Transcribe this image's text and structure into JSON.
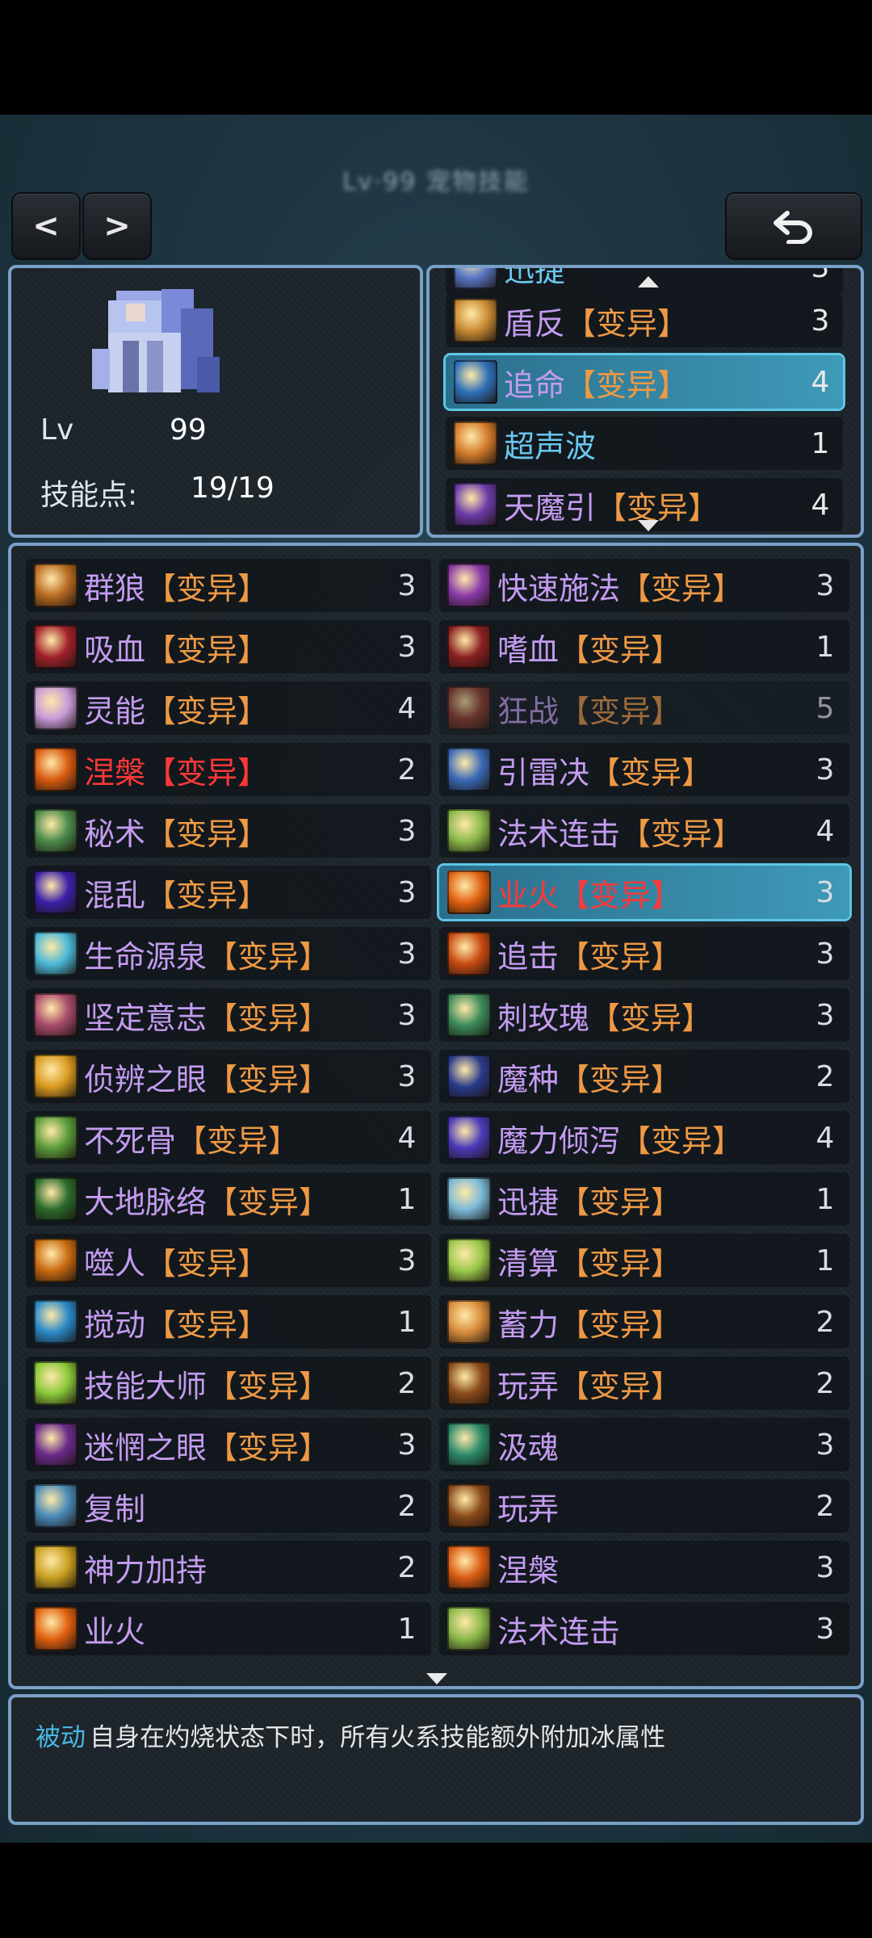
{
  "header": {
    "title": "Lv·99 宠物技能"
  },
  "nav": {
    "prev_label": "<",
    "next_label": ">"
  },
  "character": {
    "lv_label": "Lv",
    "lv_value": "99",
    "skill_points_label": "技能点:",
    "skill_points_value": "19/19"
  },
  "equipped_skills": [
    {
      "base": "迅捷",
      "level": "3",
      "partial": "top",
      "icon": "speed-icon",
      "color": "#5a78c8"
    },
    {
      "base": "盾反",
      "tag": "【变异】",
      "level": "3",
      "icon": "shield-icon",
      "color": "#c88a32"
    },
    {
      "base": "追命",
      "tag": "【变异】",
      "level": "4",
      "selected": true,
      "icon": "chase-icon",
      "color": "#2e70b8"
    },
    {
      "base": "超声波",
      "level": "1",
      "icon": "sonic-icon",
      "color": "#d27a2a"
    },
    {
      "base": "天魔引",
      "tag": "【变异】",
      "level": "4",
      "partial": "bottom",
      "icon": "demon-icon",
      "color": "#6a3aa8"
    }
  ],
  "skills": [
    {
      "base": "群狼",
      "tag": "【变异】",
      "level": "3",
      "icon": "wolf-icon",
      "color": "#b86a20"
    },
    {
      "base": "快速施法",
      "tag": "【变异】",
      "level": "3",
      "icon": "cast-icon",
      "color": "#8a3aa8"
    },
    {
      "base": "吸血",
      "tag": "【变异】",
      "level": "3",
      "icon": "blood-icon",
      "color": "#a0202a"
    },
    {
      "base": "嗜血",
      "tag": "【变异】",
      "level": "1",
      "icon": "bloodlust-icon",
      "color": "#8a2020"
    },
    {
      "base": "灵能",
      "tag": "【变异】",
      "level": "4",
      "icon": "psionic-icon",
      "color": "#c89ad8"
    },
    {
      "base": "狂战",
      "tag": "【变异】",
      "level": "5",
      "dim": true,
      "icon": "berserk-icon",
      "color": "#9a3a2a"
    },
    {
      "base": "涅槃",
      "tag": "【变异】",
      "level": "2",
      "red": true,
      "icon": "phoenix-icon",
      "color": "#d85a10"
    },
    {
      "base": "引雷决",
      "tag": "【变异】",
      "level": "3",
      "icon": "thunder-icon",
      "color": "#3a6ab8"
    },
    {
      "base": "秘术",
      "tag": "【变异】",
      "level": "3",
      "icon": "arcane-icon",
      "color": "#4a8a4a"
    },
    {
      "base": "法术连击",
      "tag": "【变异】",
      "level": "4",
      "icon": "combo-icon",
      "color": "#8ab84a"
    },
    {
      "base": "混乱",
      "tag": "【变异】",
      "level": "3",
      "icon": "chaos-icon",
      "color": "#3a20a8"
    },
    {
      "base": "业火",
      "tag": "【变异】",
      "level": "3",
      "selected": true,
      "red": true,
      "icon": "karma-fire-icon",
      "color": "#e06010"
    },
    {
      "base": "生命源泉",
      "tag": "【变异】",
      "level": "3",
      "icon": "spring-icon",
      "color": "#4ab8d8"
    },
    {
      "base": "追击",
      "tag": "【变异】",
      "level": "3",
      "icon": "pursuit-icon",
      "color": "#c84a10"
    },
    {
      "base": "坚定意志",
      "tag": "【变异】",
      "level": "3",
      "icon": "will-icon",
      "color": "#a84a6a"
    },
    {
      "base": "刺玫瑰",
      "tag": "【变异】",
      "level": "3",
      "icon": "rose-icon",
      "color": "#3a8a5a"
    },
    {
      "base": "侦辨之眼",
      "tag": "【变异】",
      "level": "3",
      "icon": "eye-icon",
      "color": "#d89a20"
    },
    {
      "base": "魔种",
      "tag": "【变异】",
      "level": "2",
      "icon": "seed-icon",
      "color": "#2a3a8a"
    },
    {
      "base": "不死骨",
      "tag": "【变异】",
      "level": "4",
      "icon": "bone-icon",
      "color": "#5a9a3a"
    },
    {
      "base": "魔力倾泻",
      "tag": "【变异】",
      "level": "4",
      "icon": "mana-icon",
      "color": "#4a3ab8"
    },
    {
      "base": "大地脉络",
      "tag": "【变异】",
      "level": "1",
      "icon": "earth-icon",
      "color": "#2a6a2a"
    },
    {
      "base": "迅捷",
      "tag": "【变异】",
      "level": "1",
      "icon": "swift-icon",
      "color": "#7ab8d8"
    },
    {
      "base": "噬人",
      "tag": "【变异】",
      "level": "3",
      "icon": "devour-icon",
      "color": "#c86a10"
    },
    {
      "base": "清算",
      "tag": "【变异】",
      "level": "1",
      "icon": "reckon-icon",
      "color": "#9ac84a"
    },
    {
      "base": "搅动",
      "tag": "【变异】",
      "level": "1",
      "icon": "stir-icon",
      "color": "#2a8ac8"
    },
    {
      "base": "蓄力",
      "tag": "【变异】",
      "level": "2",
      "icon": "charge-icon",
      "color": "#d88a3a"
    },
    {
      "base": "技能大师",
      "tag": "【变异】",
      "level": "2",
      "icon": "master-icon",
      "color": "#8ac83a"
    },
    {
      "base": "玩弄",
      "tag": "【变异】",
      "level": "2",
      "icon": "tease-icon",
      "color": "#8a4a1a"
    },
    {
      "base": "迷惘之眼",
      "tag": "【变异】",
      "level": "3",
      "icon": "confuse-eye-icon",
      "color": "#6a2a8a"
    },
    {
      "base": "汲魂",
      "level": "3",
      "icon": "soul-icon",
      "color": "#2a8a6a"
    },
    {
      "base": "复制",
      "level": "2",
      "icon": "copy-icon",
      "color": "#4a8ab8"
    },
    {
      "base": "玩弄",
      "level": "2",
      "icon": "tease-icon",
      "color": "#8a4a1a"
    },
    {
      "base": "神力加持",
      "level": "2",
      "icon": "divine-icon",
      "color": "#c8a020"
    },
    {
      "base": "涅槃",
      "level": "3",
      "icon": "phoenix-icon",
      "color": "#d85a10"
    },
    {
      "base": "业火",
      "level": "1",
      "icon": "karma-fire-icon",
      "color": "#e06010"
    },
    {
      "base": "法术连击",
      "level": "3",
      "icon": "combo-icon",
      "color": "#8ab84a"
    }
  ],
  "description": {
    "type_label": "被动",
    "text": "自身在灼烧状态下时，所有火系技能额外附加冰属性"
  }
}
